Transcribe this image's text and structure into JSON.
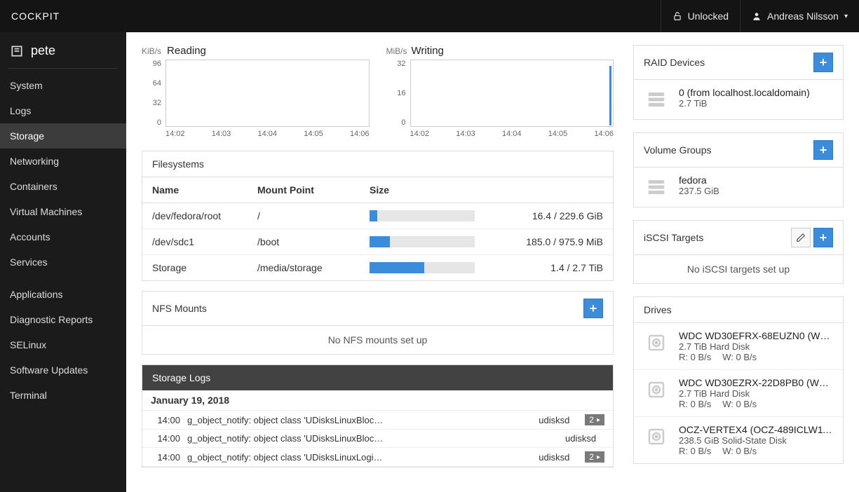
{
  "brand": "COCKPIT",
  "header": {
    "lock_label": "Unlocked",
    "user": "Andreas Nilsson"
  },
  "host": {
    "name": "pete"
  },
  "nav": {
    "items": [
      "System",
      "Logs",
      "Storage",
      "Networking",
      "Containers",
      "Virtual Machines",
      "Accounts",
      "Services"
    ],
    "items2": [
      "Applications",
      "Diagnostic Reports",
      "SELinux",
      "Software Updates",
      "Terminal"
    ],
    "active": "Storage"
  },
  "chart_data": [
    {
      "type": "line",
      "title": "Reading",
      "unit": "KiB/s",
      "y_ticks": [
        "96",
        "64",
        "32",
        "0"
      ],
      "x_ticks": [
        "14:02",
        "14:03",
        "14:04",
        "14:05",
        "14:06"
      ],
      "notes": "flat near 0"
    },
    {
      "type": "line",
      "title": "Writing",
      "unit": "MiB/s",
      "y_ticks": [
        "32",
        "16",
        "0"
      ],
      "x_ticks": [
        "14:02",
        "14:03",
        "14:04",
        "14:05",
        "14:06"
      ],
      "notes": "spike at right edge"
    }
  ],
  "filesystems": {
    "title": "Filesystems",
    "cols": {
      "name": "Name",
      "mount": "Mount Point",
      "size": "Size"
    },
    "rows": [
      {
        "name": "/dev/fedora/root",
        "mount": "/",
        "size": "16.4 / 229.6 GiB",
        "pct": 7
      },
      {
        "name": "/dev/sdc1",
        "mount": "/boot",
        "size": "185.0 / 975.9 MiB",
        "pct": 19
      },
      {
        "name": "Storage",
        "mount": "/media/storage",
        "size": "1.4 / 2.7 TiB",
        "pct": 52
      }
    ]
  },
  "nfs": {
    "title": "NFS Mounts",
    "empty": "No NFS mounts set up"
  },
  "logs": {
    "title": "Storage Logs",
    "date": "January 19, 2018",
    "rows": [
      {
        "time": "14:00",
        "msg": "g_object_notify: object class 'UDisksLinuxBloc…",
        "src": "udisksd",
        "badge": "2"
      },
      {
        "time": "14:00",
        "msg": "g_object_notify: object class 'UDisksLinuxBloc…",
        "src": "udisksd",
        "badge": ""
      },
      {
        "time": "14:00",
        "msg": "g_object_notify: object class 'UDisksLinuxLogi…",
        "src": "udisksd",
        "badge": "2"
      }
    ]
  },
  "raid": {
    "title": "RAID Devices",
    "item": {
      "name": "0 (from localhost.localdomain)",
      "size": "2.7 TiB"
    }
  },
  "vg": {
    "title": "Volume Groups",
    "item": {
      "name": "fedora",
      "size": "237.5 GiB"
    }
  },
  "iscsi": {
    "title": "iSCSI Targets",
    "empty": "No iSCSI targets set up"
  },
  "drives": {
    "title": "Drives",
    "items": [
      {
        "name": "WDC WD30EFRX-68EUZN0 (WD…",
        "sub": "2.7 TiB Hard Disk",
        "r": "R: 0 B/s",
        "w": "W: 0 B/s"
      },
      {
        "name": "WDC WD30EZRX-22D8PB0 (WD…",
        "sub": "2.7 TiB Hard Disk",
        "r": "R: 0 B/s",
        "w": "W: 0 B/s"
      },
      {
        "name": "OCZ-VERTEX4 (OCZ-489ICLW11…",
        "sub": "238.5 GiB Solid-State Disk",
        "r": "R: 0 B/s",
        "w": "W: 0 B/s"
      }
    ]
  }
}
